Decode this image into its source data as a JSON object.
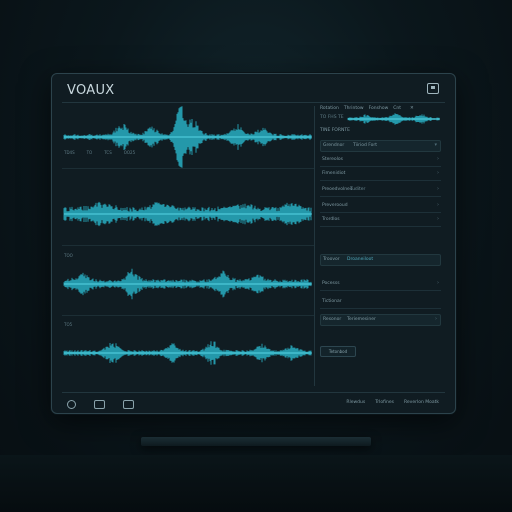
{
  "app": {
    "title": "VOAUX"
  },
  "tracks": [
    {
      "top_labels": [
        "",
        ""
      ],
      "bottom_labels": [
        "TD4S",
        "TO",
        "TCS",
        "OO25"
      ]
    },
    {
      "labels": []
    },
    {
      "labels": [
        "TOO"
      ]
    },
    {
      "labels": [
        "TO5"
      ]
    }
  ],
  "panel": {
    "tabs": [
      "Rotation",
      "Thrintow",
      "Fonshow",
      "Cnt"
    ],
    "subheader": "TO FHS TE",
    "section_label": "TINE FORNTE",
    "rows": [
      {
        "label": "Grendnor",
        "value": "Tiiriod Fort"
      },
      {
        "label": "Stereolos",
        "value": ""
      },
      {
        "label": "Fimenidiot",
        "value": ""
      },
      {
        "label": "Preoedvolnes",
        "value": "Tuditer"
      },
      {
        "label": "Preverooud",
        "value": ""
      },
      {
        "label": "Trordlos",
        "value": ""
      },
      {
        "label": "Troovor",
        "value": "Droaneiloot"
      },
      {
        "label": "Pocesss",
        "value": ""
      },
      {
        "label": "Tictionar",
        "value": ""
      },
      {
        "label": "Resonor",
        "value": "Teriemesiner"
      }
    ],
    "apply_label": "Tetonbod"
  },
  "status": {
    "left": "Rlewdus",
    "mid": "Trlofines",
    "right": "Reverlon Moatk"
  },
  "accent": "#2fd3ec"
}
